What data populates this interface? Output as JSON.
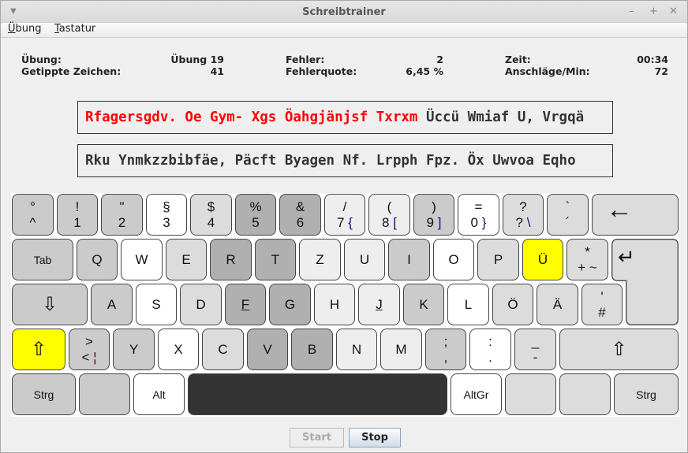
{
  "window": {
    "title": "Schreibtrainer",
    "menu_icon": "triangle-down-icon",
    "controls": [
      "–",
      "+",
      "✕"
    ]
  },
  "menu": [
    {
      "accel": "Ü",
      "rest": "bung"
    },
    {
      "accel": "T",
      "rest": "astatur"
    }
  ],
  "stats": {
    "uebung_label": "Übung:",
    "uebung_value": "Übung 19",
    "getippt_label": "Getippte Zeichen:",
    "getippt_value": "41",
    "fehler_label": "Fehler:",
    "fehler_value": "2",
    "quote_label": "Fehlerquote:",
    "quote_value": "6,45 %",
    "zeit_label": "Zeit:",
    "zeit_value": "00:34",
    "apm_label": "Anschläge/Min:",
    "apm_value": "72"
  },
  "lines": {
    "line1_typed": "Rfagersgdv. Oe Gym- Xgs Öahgjänjsf Txrxm",
    "line1_rest": " Üccü Wmiaf U, Vrgqä",
    "line2": "Rku Ynmkzzbibfäe, Päcft Byagen Nf. Lrpph Fpz. Öx Uwvoa Eqho",
    "typed_color": "#ff0000"
  },
  "shades": {
    "white": "#ffffff",
    "lightest": "#eeeeee",
    "light": "#dcdcdc",
    "mid": "#cbcbcb",
    "dark": "#b0b0b0",
    "space": "#333333",
    "highlight": "#ffff00"
  },
  "keyboard": {
    "rows": [
      [
        {
          "t": "°",
          "b": "^",
          "c": "mid"
        },
        {
          "t": "!",
          "b": "1",
          "c": "mid"
        },
        {
          "t": "\"",
          "b": "2",
          "c": "mid"
        },
        {
          "t": "§",
          "b": "3",
          "c": "white"
        },
        {
          "t": "$",
          "b": "4",
          "c": "light"
        },
        {
          "t": "%",
          "b": "5",
          "c": "dark"
        },
        {
          "t": "&",
          "b": "6",
          "c": "dark"
        },
        {
          "t": "/",
          "b": "7",
          "ag": "{",
          "c": "lightest"
        },
        {
          "t": "(",
          "b": "8",
          "ag": "[",
          "c": "lightest"
        },
        {
          "t": ")",
          "b": "9",
          "ag": "]",
          "c": "mid"
        },
        {
          "t": "=",
          "b": "0",
          "ag": "}",
          "c": "white"
        },
        {
          "t": "?",
          "b": "?",
          "ag": "\\",
          "c": "light"
        },
        {
          "t": "`",
          "b": "´",
          "c": "light"
        },
        {
          "m": "←",
          "c": "light",
          "n": "backspace"
        }
      ],
      [
        {
          "s": "Tab",
          "c": "mid"
        },
        {
          "m": "Q",
          "c": "mid"
        },
        {
          "m": "W",
          "c": "white"
        },
        {
          "m": "E",
          "c": "light"
        },
        {
          "m": "R",
          "c": "dark"
        },
        {
          "m": "T",
          "c": "dark"
        },
        {
          "m": "Z",
          "c": "lightest"
        },
        {
          "m": "U",
          "c": "lightest"
        },
        {
          "m": "I",
          "c": "mid"
        },
        {
          "m": "O",
          "c": "white"
        },
        {
          "m": "P",
          "c": "light"
        },
        {
          "m": "Ü",
          "c": "highlight"
        },
        {
          "t": "*",
          "b": "+",
          "ag": "~",
          "c": "light"
        },
        {
          "m": "↵",
          "c": "light",
          "n": "enter"
        }
      ],
      [
        {
          "m": "⇩",
          "c": "mid",
          "n": "caps-lock"
        },
        {
          "m": "A",
          "c": "mid"
        },
        {
          "m": "S",
          "c": "white"
        },
        {
          "m": "D",
          "c": "light"
        },
        {
          "m": "F",
          "c": "dark"
        },
        {
          "m": "G",
          "c": "dark"
        },
        {
          "m": "H",
          "c": "lightest"
        },
        {
          "m": "J",
          "c": "lightest"
        },
        {
          "m": "K",
          "c": "mid"
        },
        {
          "m": "L",
          "c": "white"
        },
        {
          "m": "Ö",
          "c": "light"
        },
        {
          "m": "Ä",
          "c": "light"
        },
        {
          "t": "'",
          "b": "#",
          "c": "light"
        }
      ],
      [
        {
          "m": "⇧",
          "c": "highlight",
          "n": "shift-left"
        },
        {
          "t": ">",
          "b": "<",
          "ag": "¦",
          "c": "mid"
        },
        {
          "m": "Y",
          "c": "mid"
        },
        {
          "m": "X",
          "c": "white"
        },
        {
          "m": "C",
          "c": "light"
        },
        {
          "m": "V",
          "c": "dark"
        },
        {
          "m": "B",
          "c": "dark"
        },
        {
          "m": "N",
          "c": "lightest"
        },
        {
          "m": "M",
          "c": "lightest"
        },
        {
          "t": ";",
          "b": ",",
          "c": "mid"
        },
        {
          "t": ":",
          "b": ".",
          "c": "white"
        },
        {
          "t": "_",
          "b": "-",
          "c": "light"
        },
        {
          "m": "⇧",
          "c": "light",
          "n": "shift-right"
        }
      ],
      [
        {
          "s": "Strg",
          "c": "mid"
        },
        {
          "s": "",
          "c": "mid",
          "n": "win"
        },
        {
          "s": "Alt",
          "c": "white"
        },
        {
          "s": "",
          "c": "space",
          "n": "space"
        },
        {
          "s": "AltGr",
          "c": "white"
        },
        {
          "s": "",
          "c": "light",
          "n": "win-right"
        },
        {
          "s": "",
          "c": "light",
          "n": "menu"
        },
        {
          "s": "Strg",
          "c": "light"
        }
      ]
    ]
  },
  "buttons": {
    "start": "Start",
    "stop": "Stop"
  }
}
